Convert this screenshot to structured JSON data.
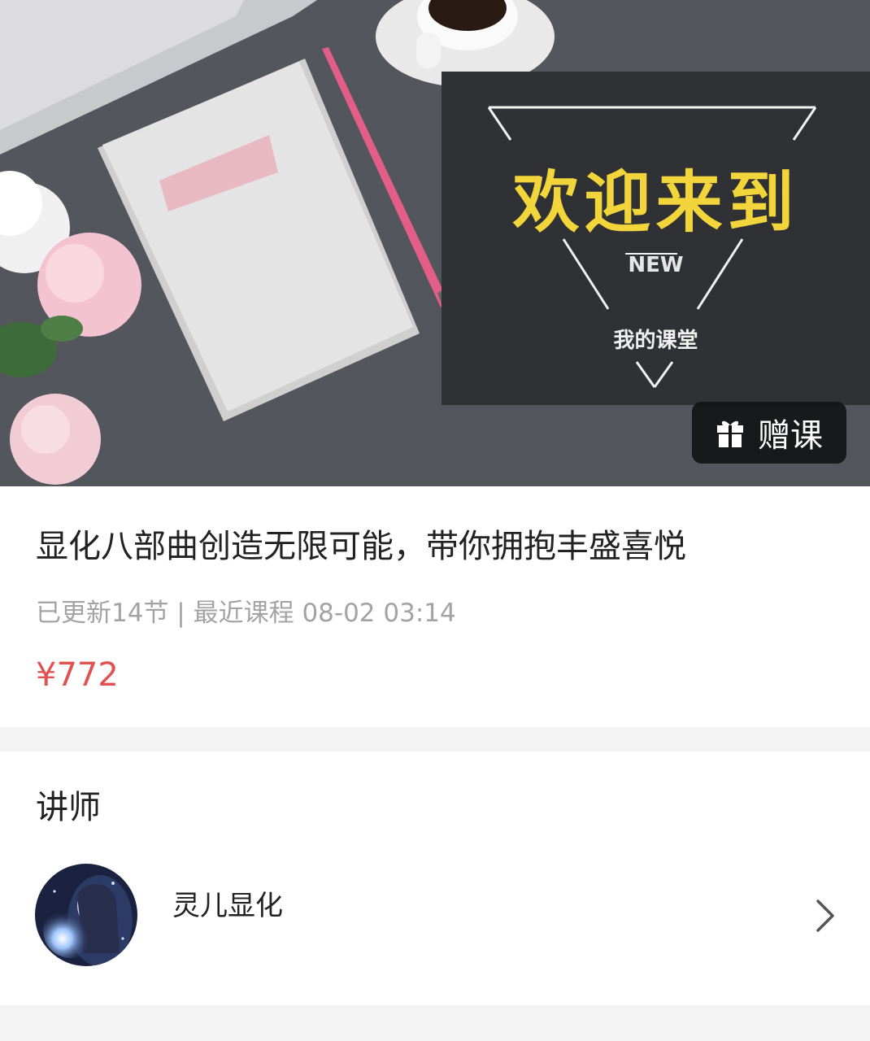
{
  "banner": {
    "welcome_title": "欢迎来到",
    "welcome_new": "NEW",
    "welcome_sub": "我的课堂",
    "gift_label": "赠课"
  },
  "course": {
    "title": "显化八部曲创造无限可能，带你拥抱丰盛喜悦",
    "meta": "已更新14节 | 最近课程 08-02 03:14",
    "price": "¥772"
  },
  "lecturer_section": {
    "title": "讲师",
    "name": "灵儿显化"
  },
  "colors": {
    "price": "#e0514f",
    "welcome_title": "#f2d43b",
    "banner_bg": "#54565d"
  },
  "icons": [
    "gift-icon",
    "chevron-right-icon",
    "lecturer-avatar"
  ]
}
